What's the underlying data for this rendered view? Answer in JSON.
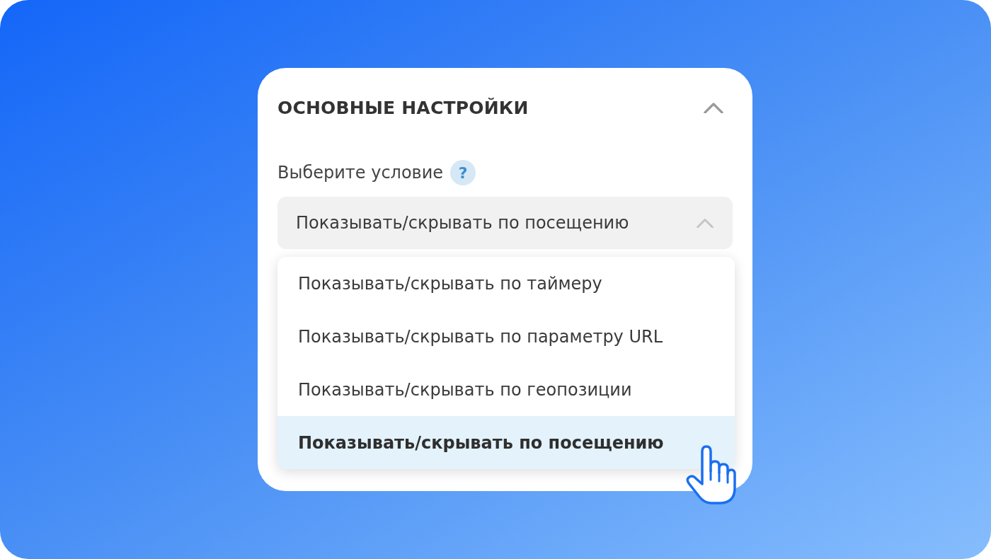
{
  "panel": {
    "title": "ОСНОВНЫЕ НАСТРОЙКИ",
    "expanded": true
  },
  "condition": {
    "label": "Выберите условие",
    "help": "?",
    "value": "Показывать/скрывать по посещению",
    "open": true
  },
  "options": [
    {
      "label": "Показывать/скрывать по таймеру",
      "selected": false
    },
    {
      "label": "Показывать/скрывать по параметру URL",
      "selected": false
    },
    {
      "label": "Показывать/скрывать по геопозиции",
      "selected": false
    },
    {
      "label": "Показывать/скрывать по посещению",
      "selected": true
    }
  ]
}
